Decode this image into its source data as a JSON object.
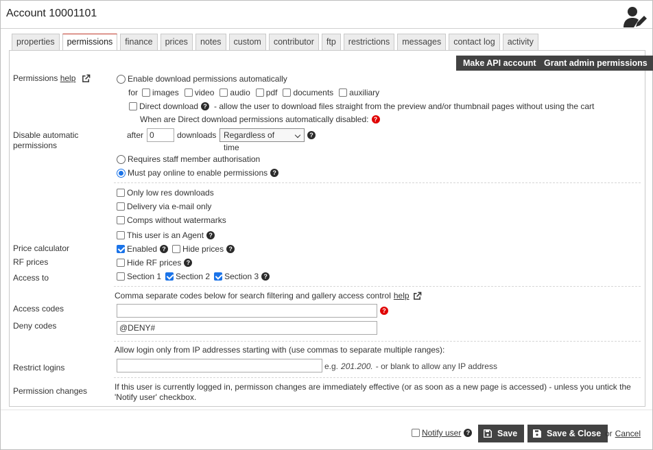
{
  "window": {
    "title": "Account 10001101"
  },
  "tabs": [
    "properties",
    "permissions",
    "finance",
    "prices",
    "notes",
    "custom",
    "contributor",
    "ftp",
    "restrictions",
    "messages",
    "contact log",
    "activity"
  ],
  "active_tab": "permissions",
  "header_buttons": {
    "make_api": "Make API account",
    "grant_admin": "Grant admin permissions"
  },
  "labels": {
    "permissions": "Permissions",
    "help": "help",
    "disable_auto": "Disable automatic permissions",
    "price_calculator": "Price calculator",
    "rf_prices": "RF prices",
    "access_to": "Access to",
    "access_codes": "Access codes",
    "deny_codes": "Deny codes",
    "restrict_logins": "Restrict logins",
    "permission_changes": "Permission changes"
  },
  "download": {
    "enable_auto": "Enable download permissions automatically",
    "for": "for",
    "types": [
      "images",
      "video",
      "audio",
      "pdf",
      "documents",
      "auxiliary"
    ],
    "direct_download": "Direct download",
    "direct_download_desc": "- allow the user to download files straight from the preview and/or thumbnail pages without using the cart",
    "when_disabled": "When are Direct download permissions automatically disabled:",
    "after": "after",
    "after_value": "0",
    "downloads": "downloads",
    "time_option": "Regardless of time",
    "requires_staff": "Requires staff member authorisation",
    "must_pay": "Must pay online to enable permissions"
  },
  "options": {
    "low_res": "Only low res downloads",
    "email_only": "Delivery via e-mail only",
    "comps": "Comps without watermarks",
    "agent": "This user is an Agent"
  },
  "price_calc": {
    "enabled": "Enabled",
    "hide_prices": "Hide prices"
  },
  "rf": {
    "hide_rf": "Hide RF prices"
  },
  "sections": [
    "Section 1",
    "Section 2",
    "Section 3"
  ],
  "codes": {
    "intro": "Comma separate codes below for search filtering and gallery access control",
    "help": "help",
    "access_value": "",
    "deny_value": "@DENY#"
  },
  "ip": {
    "intro": "Allow login only from IP addresses starting with (use commas to separate multiple ranges):",
    "eg": "e.g.",
    "example": "201.200.",
    "suffix": "- or blank to allow any IP address",
    "value": ""
  },
  "changes_text": "If this user is currently logged in, permisson changes are immediately effective (or as soon as a new page is accessed) - unless you untick the 'Notify user' checkbox.",
  "footer": {
    "notify_user": "Notify user",
    "save": "Save",
    "save_close": "Save & Close",
    "or": "or",
    "cancel": "Cancel"
  }
}
